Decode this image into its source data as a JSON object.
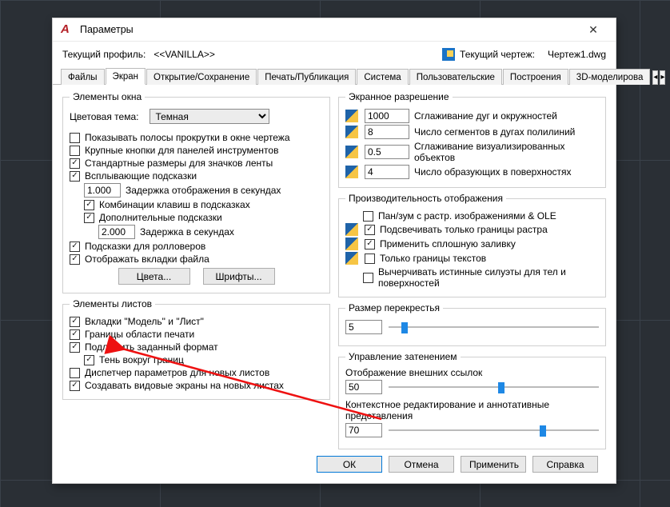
{
  "window": {
    "title": "Параметры",
    "close_glyph": "✕"
  },
  "header": {
    "profile_label": "Текущий профиль:",
    "profile_value": "<<VANILLA>>",
    "drawing_label": "Текущий чертеж:",
    "drawing_value": "Чертеж1.dwg"
  },
  "tabs": [
    "Файлы",
    "Экран",
    "Открытие/Сохранение",
    "Печать/Публикация",
    "Система",
    "Пользовательские",
    "Построения",
    "3D-моделирова"
  ],
  "active_tab": 1,
  "nav": {
    "left": "◂",
    "right": "▸"
  },
  "window_elements": {
    "legend": "Элементы окна",
    "color_theme_label": "Цветовая тема:",
    "color_theme_value": "Темная",
    "show_scrollbars": "Показывать полосы прокрутки в окне чертежа",
    "large_buttons": "Крупные кнопки для панелей инструментов",
    "std_ribbon_icons": "Стандартные размеры для значков ленты",
    "tooltips": "Всплывающие подсказки",
    "tooltip_delay_value": "1.000",
    "tooltip_delay_label": "Задержка отображения в секундах",
    "kbd_combos": "Комбинации клавиш в подсказках",
    "extra_hints": "Дополнительные подсказки",
    "extra_delay_value": "2.000",
    "extra_delay_label": "Задержка в секундах",
    "rollover": "Подсказки для ролловеров",
    "file_tabs": "Отображать вкладки файла",
    "btn_colors": "Цвета...",
    "btn_fonts": "Шрифты..."
  },
  "layout_elements": {
    "legend": "Элементы листов",
    "model_layout_tabs": "Вкладки \"Модель\" и \"Лист\"",
    "print_area": "Границы области печати",
    "paper_format": "Подложить заданный формат",
    "shadow": "Тень вокруг границ",
    "page_mgr": "Диспетчер параметров для новых листов",
    "create_viewports": "Создавать видовые экраны на новых листах"
  },
  "screen_res": {
    "legend": "Экранное разрешение",
    "arc_value": "1000",
    "arc_label": "Сглаживание дуг и окружностей",
    "polyline_value": "8",
    "polyline_label": "Число сегментов в дугах полилиний",
    "rendered_value": "0.5",
    "rendered_label": "Сглаживание визуализированных объектов",
    "surf_value": "4",
    "surf_label": "Число образующих в поверхностях"
  },
  "perf": {
    "legend": "Производительность отображения",
    "pan_zoom": "Пан/зум с растр. изображениями & OLE",
    "raster_bounds": "Подсвечивать только границы растра",
    "solid_fill": "Применить сплошную заливку",
    "text_bounds": "Только границы текстов",
    "true_silhouettes": "Вычерчивать истинные силуэты для тел и поверхностей"
  },
  "crosshair": {
    "legend": "Размер перекрестья",
    "value": "5"
  },
  "fade": {
    "legend": "Управление затенением",
    "xref_label": "Отображение внешних ссылок",
    "xref_value": "50",
    "inplace_label": "Контекстное редактирование и аннотативные представления",
    "inplace_value": "70"
  },
  "footer": {
    "ok": "ОК",
    "cancel": "Отмена",
    "apply": "Применить",
    "help": "Справка"
  }
}
